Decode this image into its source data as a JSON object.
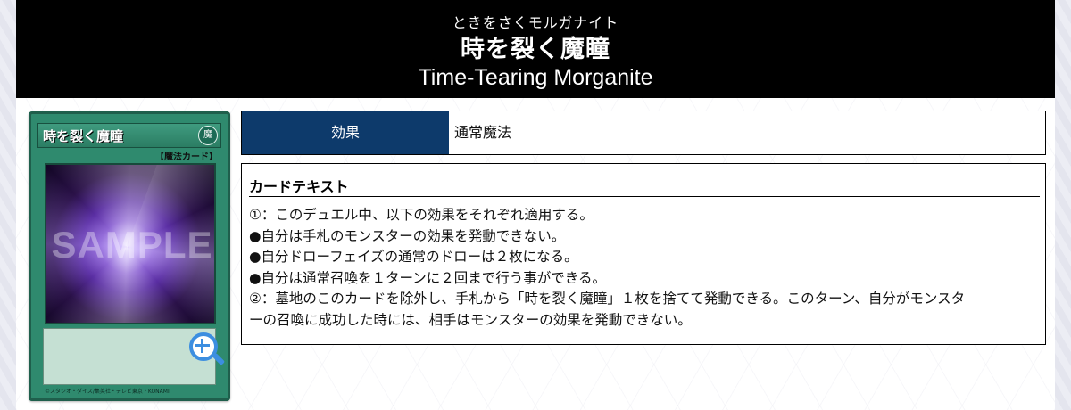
{
  "header": {
    "ruby": "ときをさくモルガナイト",
    "name_jp": "時を裂く魔瞳",
    "name_en": "Time-Tearing Morganite"
  },
  "card_image": {
    "name": "時を裂く魔瞳",
    "attribute": "魔",
    "type_line": "【魔法カード】",
    "watermark": "SAMPLE",
    "copyright": "©スタジオ・ダイス/集英社・テレビ東京・KONAMI",
    "frame_color": "#2f8a6e",
    "zoom_icon": "zoom-in-icon"
  },
  "card_type": {
    "label": "効果",
    "value": "通常魔法",
    "label_bg": "#0d3a6b"
  },
  "card_text": {
    "heading": "カードテキスト",
    "lines": [
      "①：このデュエル中、以下の効果をそれぞれ適用する。",
      "●自分は手札のモンスターの効果を発動できない。",
      "●自分ドローフェイズの通常のドローは２枚になる。",
      "●自分は通常召喚を１ターンに２回まで行う事ができる。",
      "②：墓地のこのカードを除外し、手札から「時を裂く魔瞳」１枚を捨てて発動できる。このターン、自分がモンスタ",
      "ーの召喚に成功した時には、相手はモンスターの効果を発動できない。"
    ]
  }
}
